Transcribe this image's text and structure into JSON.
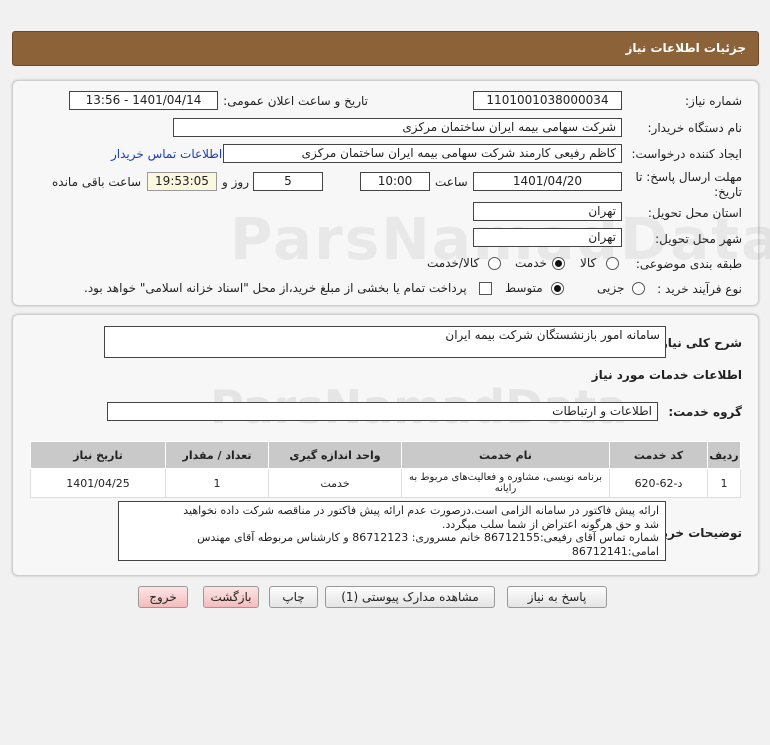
{
  "header": {
    "title": "جزئیات اطلاعات نیاز"
  },
  "form": {
    "need_number_label": "شماره نیاز:",
    "need_number": "1101001038000034",
    "announce_label": "تاریخ و ساعت اعلان عمومی:",
    "announce_value": "1401/04/14 - 13:56",
    "buyer_org_label": "نام دستگاه خریدار:",
    "buyer_org": "شرکت سهامی بیمه ایران ساختمان مرکزی",
    "creator_label": "ایجاد کننده درخواست:",
    "creator": "کاظم رفیعی کارمند شرکت سهامی بیمه ایران ساختمان مرکزی",
    "contact_link": "اطلاعات تماس خریدار",
    "deadline_label_1": "مهلت ارسال پاسخ: تا",
    "deadline_label_2": "تاریخ:",
    "deadline_date": "1401/04/20",
    "time_label": "ساعت",
    "deadline_time": "10:00",
    "days_value": "5",
    "days_label": "روز و",
    "remaining_time": "19:53:05",
    "remaining_label": "ساعت باقی مانده",
    "province_label": "استان محل تحویل:",
    "province": "تهران",
    "city_label": "شهر محل تحویل:",
    "city": "تهران",
    "category_label": "طبقه بندی موضوعی:",
    "category_options": [
      "کالا",
      "خدمت",
      "کالا/خدمت"
    ],
    "process_label": "نوع فرآیند خرید :",
    "process_options": [
      "جزیی",
      "متوسط"
    ],
    "payment_text": "پرداخت تمام یا بخشی از مبلغ خرید،از محل \"اسناد خزانه اسلامی\" خواهد بود."
  },
  "summary": {
    "label": "شرح کلی نیاز:",
    "value": "سامانه امور بازنشستگان شرکت بیمه ایران",
    "services_title": "اطلاعات خدمات مورد نیاز",
    "group_label": "گروه خدمت:",
    "group_value": "اطلاعات و ارتباطات"
  },
  "table": {
    "headers": [
      "ردیف",
      "کد خدمت",
      "نام خدمت",
      "واحد اندازه گیری",
      "تعداد / مقدار",
      "تاریخ نیاز"
    ],
    "rows": [
      [
        "1",
        "د-62-620",
        "برنامه نویسی، مشاوره و فعالیت‌های مربوط به رایانه",
        "خدمت",
        "1",
        "1401/04/25"
      ]
    ]
  },
  "notes": {
    "label": "توضیحات خریدار:",
    "lines": [
      "ارائه پیش فاکتور در سامانه الزامی است.درصورت عدم ارائه پیش فاکتور در مناقصه شرکت داده نخواهید",
      "شد و حق هرگونه اعتراض از شما سلب میگردد.",
      "شماره تماس آقای رفیعی:86712155  خانم مسروری: 86712123 و کارشناس مربوطه آقای مهندس",
      "امامی:86712141"
    ]
  },
  "buttons": {
    "reply": "پاسخ به نیاز",
    "attachments": "مشاهده مدارک پیوستی (1)",
    "print": "چاپ",
    "back": "بازگشت",
    "exit": "خروج"
  },
  "watermark": {
    "text": "ParsNamadData"
  },
  "colors": {
    "header_bg": "#8c6239",
    "link": "#1a3fb3"
  }
}
